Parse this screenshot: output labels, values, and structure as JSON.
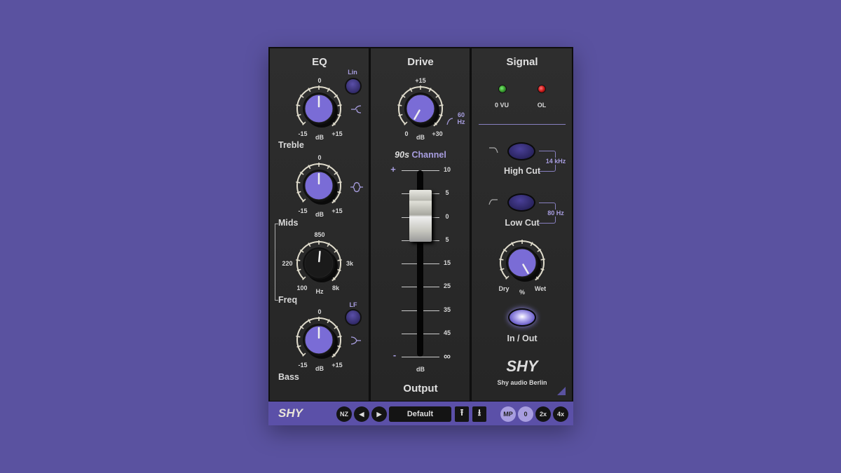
{
  "eq": {
    "title": "EQ",
    "lin_label": "Lin",
    "lf_label": "LF",
    "treble": {
      "label": "Treble",
      "top": "0",
      "min": "-15",
      "unit": "dB",
      "max": "+15"
    },
    "mids": {
      "label": "Mids",
      "top": "0",
      "min": "-15",
      "unit": "dB",
      "max": "+15"
    },
    "freq": {
      "label": "Freq",
      "top": "850",
      "left": "220",
      "right": "3k",
      "min": "100",
      "unit": "Hz",
      "max": "8k"
    },
    "bass": {
      "label": "Bass",
      "top": "0",
      "min": "-15",
      "unit": "dB",
      "max": "+15"
    }
  },
  "drive": {
    "title": "Drive",
    "top": "+15",
    "min": "0",
    "unit": "dB",
    "max": "+30",
    "hp_value": "60",
    "hp_unit": "Hz",
    "channel_prefix": "90s",
    "channel_label": "Channel",
    "fader": {
      "plus": "+",
      "minus": "-",
      "unit": "dB",
      "marks": [
        "10",
        "5",
        "0",
        "5",
        "15",
        "25",
        "35",
        "45",
        "∞"
      ]
    },
    "output_label": "Output"
  },
  "signal": {
    "title": "Signal",
    "vu_label": "0 VU",
    "ol_label": "OL",
    "vu_color": "#3a9a2a",
    "ol_color": "#c81818",
    "high_cut": {
      "label": "High Cut",
      "value": "14 kHz"
    },
    "low_cut": {
      "label": "Low Cut",
      "value": "80 Hz"
    },
    "mix": {
      "min": "Dry",
      "unit": "%",
      "max": "Wet"
    },
    "inout_label": "In / Out",
    "logo": "SHY",
    "brand": "Shy audio Berlin"
  },
  "footer": {
    "logo": "SHY",
    "nz": "NZ",
    "prev": "◀",
    "next": "▶",
    "preset": "Default",
    "upload": "⭱",
    "download": "⭳",
    "mp": "MP",
    "o0": "0",
    "o2": "2x",
    "o4": "4x"
  },
  "colors": {
    "accent": "#7a6cd6",
    "background": "#5a52a0",
    "panel": "#2a2a2a"
  }
}
